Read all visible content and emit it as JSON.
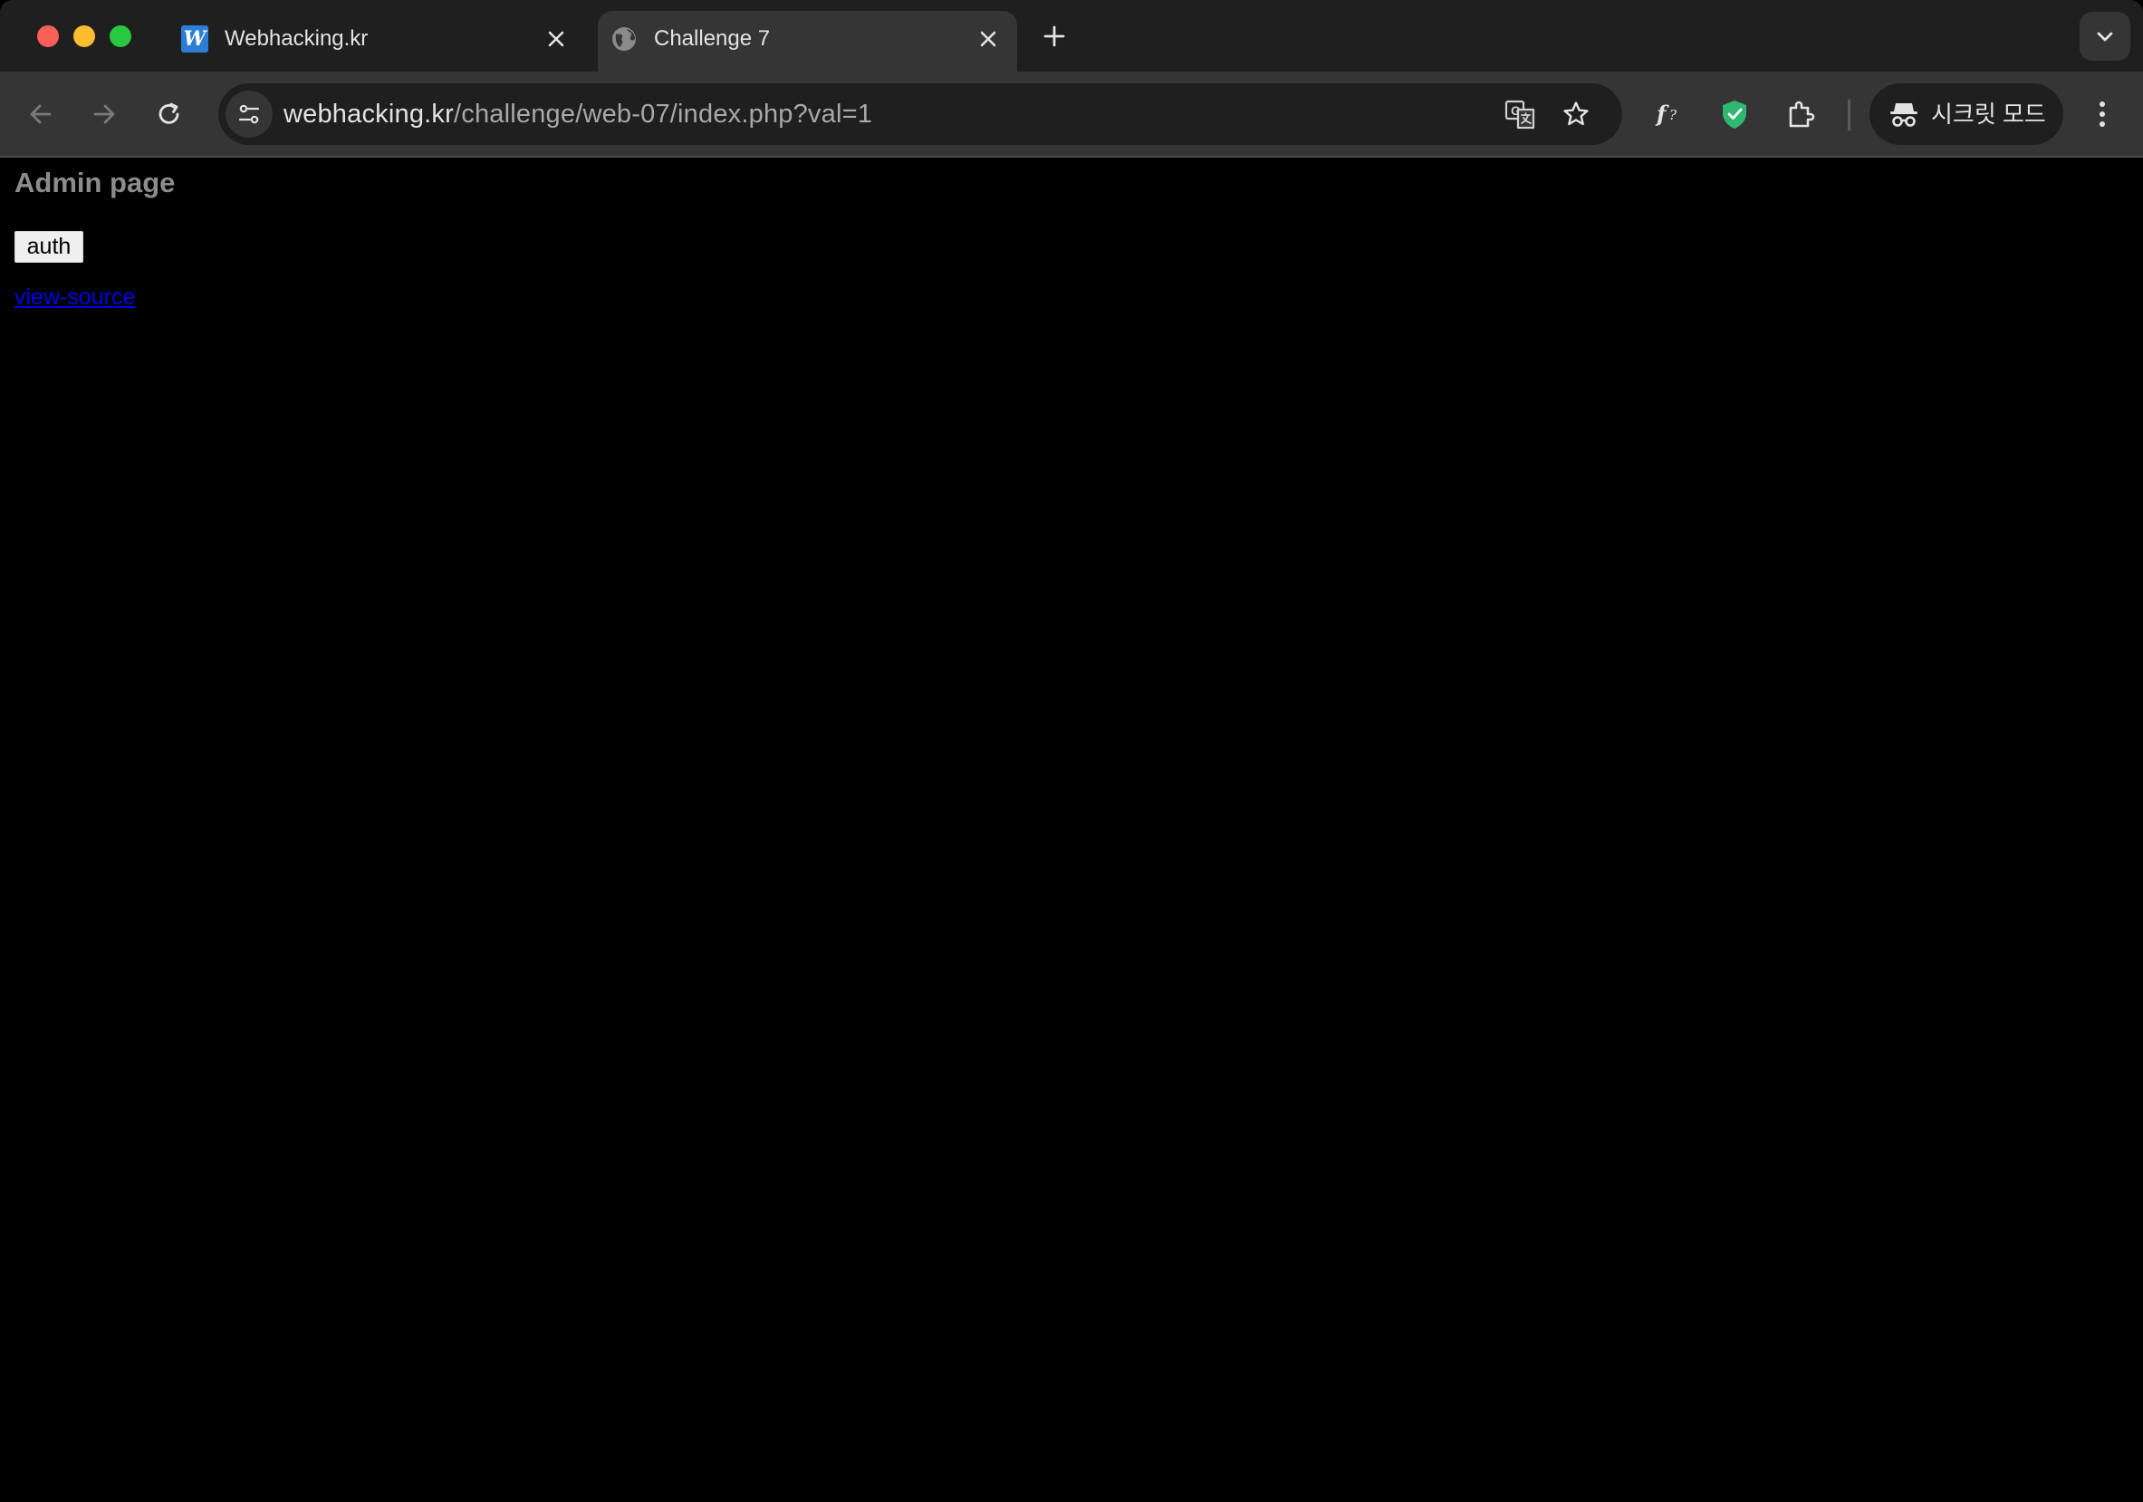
{
  "browser": {
    "tabs": [
      {
        "title": "Webhacking.kr",
        "favicon": "W",
        "active": false
      },
      {
        "title": "Challenge 7",
        "favicon": "globe-icon",
        "active": true
      }
    ],
    "url": {
      "domain": "webhacking.kr",
      "path": "/challenge/web-07/index.php?val=1"
    },
    "incognito_label": "시크릿 모드",
    "colors": {
      "tabstrip": "#1f1f1f",
      "toolbar": "#353535",
      "shield_green": "#2eb872"
    }
  },
  "page": {
    "heading": "Admin page",
    "auth_button": "auth",
    "view_source_link": "view-source",
    "colors": {
      "background": "#000000",
      "heading": "#8c8c8c",
      "link": "#0000ee"
    }
  }
}
